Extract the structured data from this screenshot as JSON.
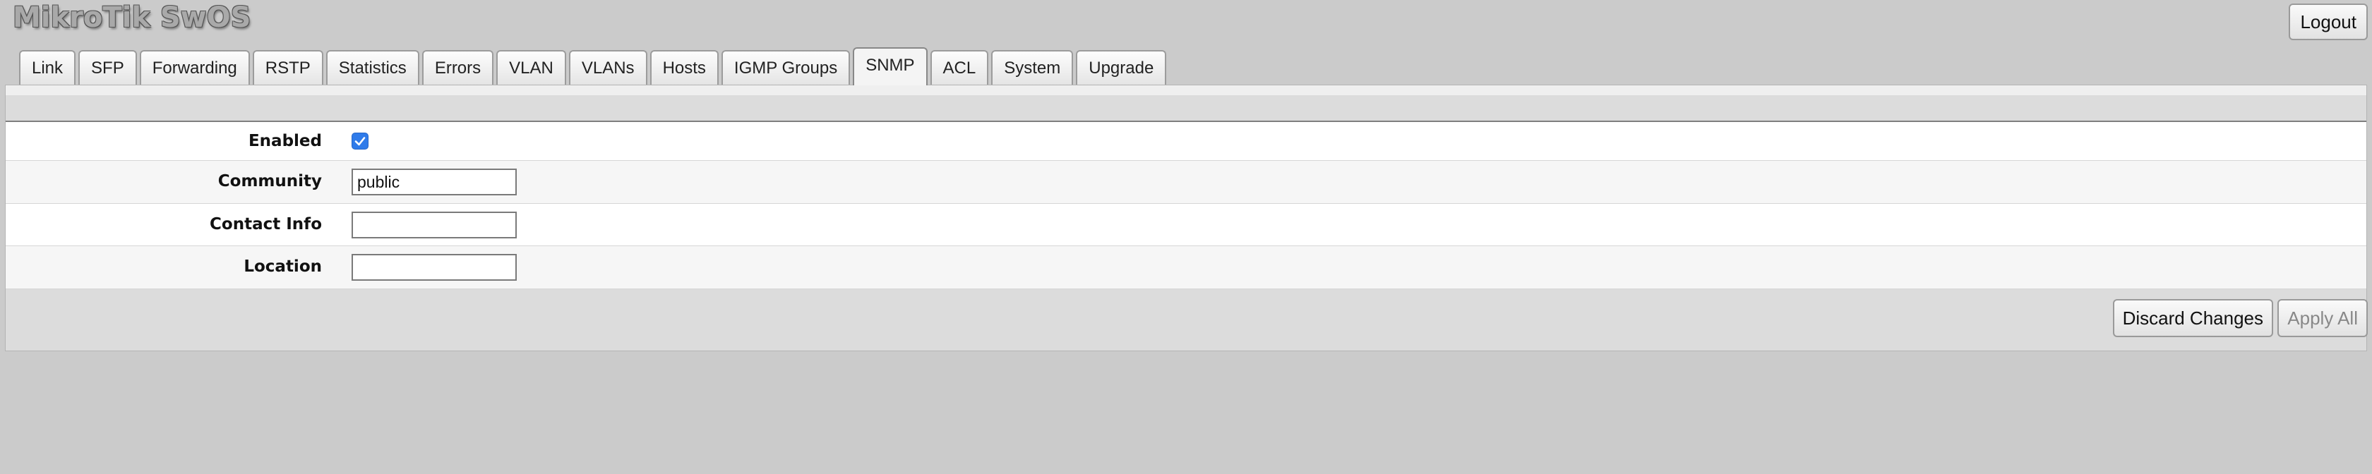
{
  "header": {
    "brand": "MikroTik SwOS",
    "logout_label": "Logout"
  },
  "tabs": [
    {
      "label": "Link",
      "active": false
    },
    {
      "label": "SFP",
      "active": false
    },
    {
      "label": "Forwarding",
      "active": false
    },
    {
      "label": "RSTP",
      "active": false
    },
    {
      "label": "Statistics",
      "active": false
    },
    {
      "label": "Errors",
      "active": false
    },
    {
      "label": "VLAN",
      "active": false
    },
    {
      "label": "VLANs",
      "active": false
    },
    {
      "label": "Hosts",
      "active": false
    },
    {
      "label": "IGMP Groups",
      "active": false
    },
    {
      "label": "SNMP",
      "active": true
    },
    {
      "label": "ACL",
      "active": false
    },
    {
      "label": "System",
      "active": false
    },
    {
      "label": "Upgrade",
      "active": false
    }
  ],
  "snmp_form": {
    "enabled": {
      "label": "Enabled",
      "checked": true
    },
    "community": {
      "label": "Community",
      "value": "public"
    },
    "contact_info": {
      "label": "Contact Info",
      "value": ""
    },
    "location": {
      "label": "Location",
      "value": ""
    }
  },
  "actions": {
    "discard_label": "Discard Changes",
    "apply_label": "Apply All",
    "apply_enabled": false
  },
  "colors": {
    "page_background": "#cbcbcb",
    "checkbox_accent": "#2f7bea"
  }
}
